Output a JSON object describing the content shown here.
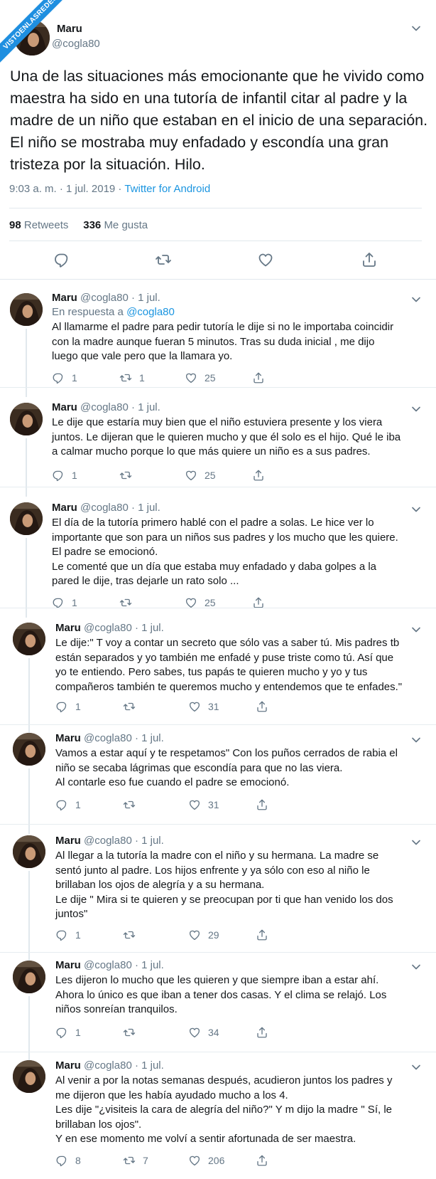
{
  "watermark": "VISTOENLASREDES",
  "main": {
    "name": "Maru",
    "handle": "@cogla80",
    "text": "Una de las situaciones más emocionante que he vivido como maestra ha sido en una tutoría de infantil citar al padre y la madre de un niño que estaban en el inicio de una separación. El niño se mostraba muy enfadado y escondía una gran tristeza por la situación. Hilo.",
    "time": "9:03 a. m. · 1 jul. 2019 · ",
    "source": "Twitter for Android",
    "retweets_count": "98",
    "retweets_label": "Retweets",
    "likes_count": "336",
    "likes_label": "Me gusta"
  },
  "replies": [
    {
      "name": "Maru",
      "handle": "@cogla80 · 1 jul.",
      "in_reply_prefix": "En respuesta a ",
      "in_reply_handle": "@cogla80",
      "text": "Al llamarme el padre para pedir  tutoría le dije si no le importaba coincidir\ncon la madre aunque fueran 5 minutos. Tras su duda inicial , me dijo\nluego que vale pero que la llamara yo.",
      "replies": "1",
      "retweets": "1",
      "likes": "25"
    },
    {
      "name": "Maru",
      "handle": "@cogla80 · 1 jul.",
      "text": "Le dije que estaría muy bien que el niño estuviera presente y los viera\njuntos. Le dijeran que le quieren mucho y que él solo es el hijo. Qué le iba\na calmar mucho porque lo que más quiere un niño es a sus padres.",
      "replies": "1",
      "retweets": "",
      "likes": "25"
    },
    {
      "name": "Maru",
      "handle": "@cogla80 · 1 jul.",
      "text": "El día de la tutoría primero hablé con el padre a solas. Le hice ver lo\nimportante que son para un niños sus padres y los mucho que les quiere.\nEl padre se emocionó.\nLe comenté que un día que estaba muy enfadado y daba golpes a la\npared le dije, tras dejarle un rato solo ...",
      "replies": "1",
      "retweets": "",
      "likes": "25"
    },
    {
      "name": "Maru",
      "handle": "@cogla80 · 1 jul.",
      "text": "Le dije:\" T voy a contar un secreto que sólo vas a saber tú. Mis padres tb\nestán separados y yo también me enfadé y puse triste como tú. Así que\nyo te entiendo. Pero sabes, tus papás te quieren mucho y yo y tus\ncompañeros también te queremos mucho y entendemos que te enfades.\"",
      "replies": "1",
      "retweets": "",
      "likes": "31"
    },
    {
      "name": "Maru",
      "handle": "@cogla80 · 1 jul.",
      "text": "Vamos a estar aquí y te respetamos\" Con los puños cerrados de rabia el\nniño se secaba lágrimas que escondía para que no las viera.\nAl contarle eso fue cuando el padre se emocionó.",
      "replies": "1",
      "retweets": "",
      "likes": "31"
    },
    {
      "name": "Maru",
      "handle": "@cogla80 · 1 jul.",
      "text": "Al llegar a la tutoría la madre con el niño y su hermana. La madre se\nsentó junto al padre. Los hijos enfrente y ya sólo con eso al niño le\nbrillaban los ojos de alegría y a su hermana.\nLe dije \" Mira si te quieren y se preocupan por ti que han venido los dos\njuntos\"",
      "replies": "1",
      "retweets": "",
      "likes": "29"
    },
    {
      "name": "Maru",
      "handle": "@cogla80 · 1 jul.",
      "text": "Les dijeron lo mucho que les quieren y que siempre iban a estar ahí.\nAhora lo único es que iban a tener dos casas. Y el clima se relajó. Los\nniños sonreían tranquilos.",
      "replies": "1",
      "retweets": "",
      "likes": "34"
    },
    {
      "name": "Maru",
      "handle": "@cogla80 · 1 jul.",
      "text": "Al venir a por la notas semanas después, acudieron juntos los padres y\nme dijeron que les había ayudado mucho a los 4.\nLes dije \"¿visiteis la cara de alegría del niño?\" Y m dijo la madre \" Sí, le\nbrillaban los ojos\".\nY en ese momento me volví a sentir afortunada de ser maestra.",
      "replies": "8",
      "retweets": "7",
      "likes": "206"
    }
  ]
}
